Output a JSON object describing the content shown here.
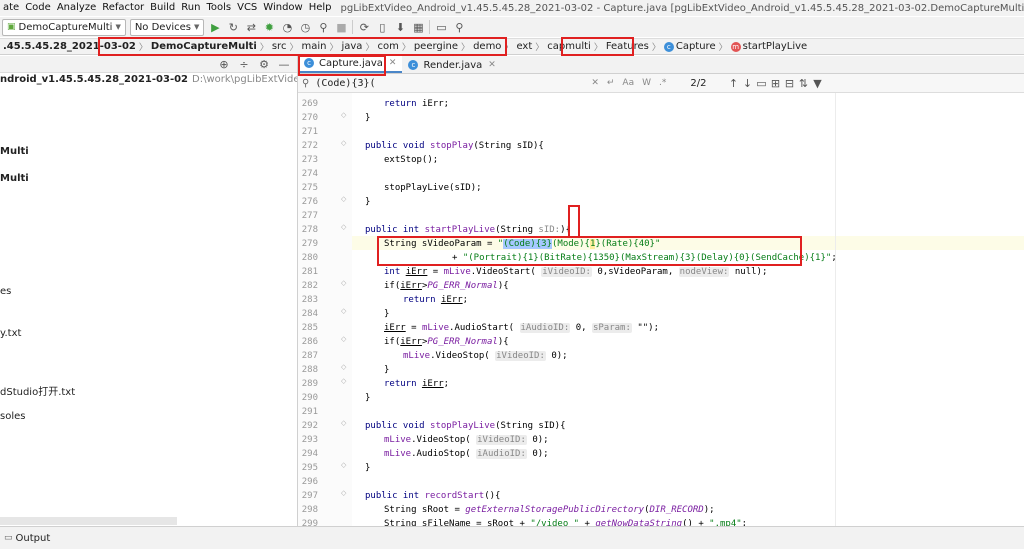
{
  "menu": {
    "items": [
      "ate",
      "Code",
      "Analyze",
      "Refactor",
      "Build",
      "Run",
      "Tools",
      "VCS",
      "Window",
      "Help"
    ],
    "window_title": "pgLibExtVideo_Android_v1.45.5.45.28_2021-03-02 - Capture.java [pgLibExtVideo_Android_v1.45.5.45.28_2021-03-02.DemoCaptureMulti] - Android Studio"
  },
  "toolbar": {
    "config": "DemoCaptureMulti",
    "device": "No Devices"
  },
  "breadcrumb": {
    "root": ".45.5.45.28_2021-03-02",
    "module": "DemoCaptureMulti",
    "parts": [
      "src",
      "main",
      "java",
      "com",
      "peergine",
      "demo",
      "ext",
      "capmulti",
      "Features"
    ],
    "class": "Capture",
    "method": "startPlayLive"
  },
  "project": {
    "name": "ndroid_v1.45.5.45.28_2021-03-02",
    "path": "D:\\work\\pgLibExtVideo\\android\\pgLibExtVi",
    "items": [
      "Multi",
      "Multi",
      "es",
      "y.txt",
      "dStudio打开.txt",
      "soles"
    ]
  },
  "tabs": [
    {
      "label": "Capture.java",
      "active": true
    },
    {
      "label": "Render.java",
      "active": false
    }
  ],
  "search": {
    "query": "(Code){3}(",
    "match_count": "2/2",
    "options": [
      "Aa",
      "W",
      ".*"
    ]
  },
  "line_numbers": [
    "269",
    "270",
    "271",
    "272",
    "273",
    "274",
    "275",
    "276",
    "277",
    "278",
    "279",
    "280",
    "281",
    "282",
    "283",
    "284",
    "285",
    "286",
    "287",
    "288",
    "289",
    "290",
    "291",
    "292",
    "293",
    "294",
    "295",
    "296",
    "297",
    "298",
    "299"
  ],
  "hints": {
    "sid": "sID:",
    "video_id": "iVideoID:",
    "node_view": "nodeView:",
    "audio_id": "iAudioID:",
    "param": "sParam:"
  },
  "code": {
    "l269": "return iErr;",
    "l273": "extStop();",
    "l275": "stopPlayLive(sID);",
    "l272_a": "public void ",
    "l272_fn": "stopPlay",
    "l272_b": "(String sID){",
    "l278_a": "public int ",
    "l278_fn": "startPlayLive",
    "l278_b": "(String sID){",
    "l279_a": "String sVideoParam = ",
    "l279_q": "\"",
    "l279_sel": "(Code){3}",
    "l279_b": "(Mode){",
    "l279_hl": "1",
    "l279_c": "}(Rate){40}\"",
    "l280_a": "+ ",
    "l280_str": "\"(Portrait){1}(BitRate){1350}(MaxStream){3}(Delay){0}(SendCache){1}\"",
    "l280_end": ";",
    "l281_a": "int ",
    "l281_var": "iErr",
    "l281_b": " = ",
    "l281_obj": "mLive",
    "l281_c": ".VideoStart( ",
    "l281_d": " 0,sVideoParam, ",
    "l281_e": " null);",
    "l282_a": "if(",
    "l282_var": "iErr",
    "l282_b": ">",
    "l282_const": "PG_ERR_Normal",
    "l282_c": "){",
    "l283_a": "return ",
    "l283_var": "iErr",
    "l283_b": ";",
    "brace": "}",
    "l285_var": "iErr",
    "l285_a": " = ",
    "l285_obj": "mLive",
    "l285_b": ".AudioStart( ",
    "l285_c": " 0, ",
    "l285_d": " \"\");",
    "l287_obj": "mLive",
    "l287_a": ".VideoStop( ",
    "l287_b": " 0);",
    "l292_fn": "stopPlayLive",
    "l293_obj": "mLive",
    "l293_a": ".VideoStop( ",
    "l293_b": " 0);",
    "l294_obj": "mLive",
    "l294_a": ".AudioStop( ",
    "l294_b": " 0);",
    "l297_fn": "recordStart",
    "l297_b": "(){",
    "l298_a": "String sRoot = ",
    "l298_fn": "getExternalStoragePublicDirectory",
    "l298_b": "(",
    "l298_const": "DIR_RECORD",
    "l298_c": ");",
    "l299_a": "String sFileName = sRoot + ",
    "l299_s1": "\"/video_\"",
    "l299_b": " + ",
    "l299_fn": "getNowDataString",
    "l299_c": "() + ",
    "l299_s2": "\".mp4\"",
    "l299_d": ";"
  },
  "bottom": {
    "output_label": "Output"
  }
}
